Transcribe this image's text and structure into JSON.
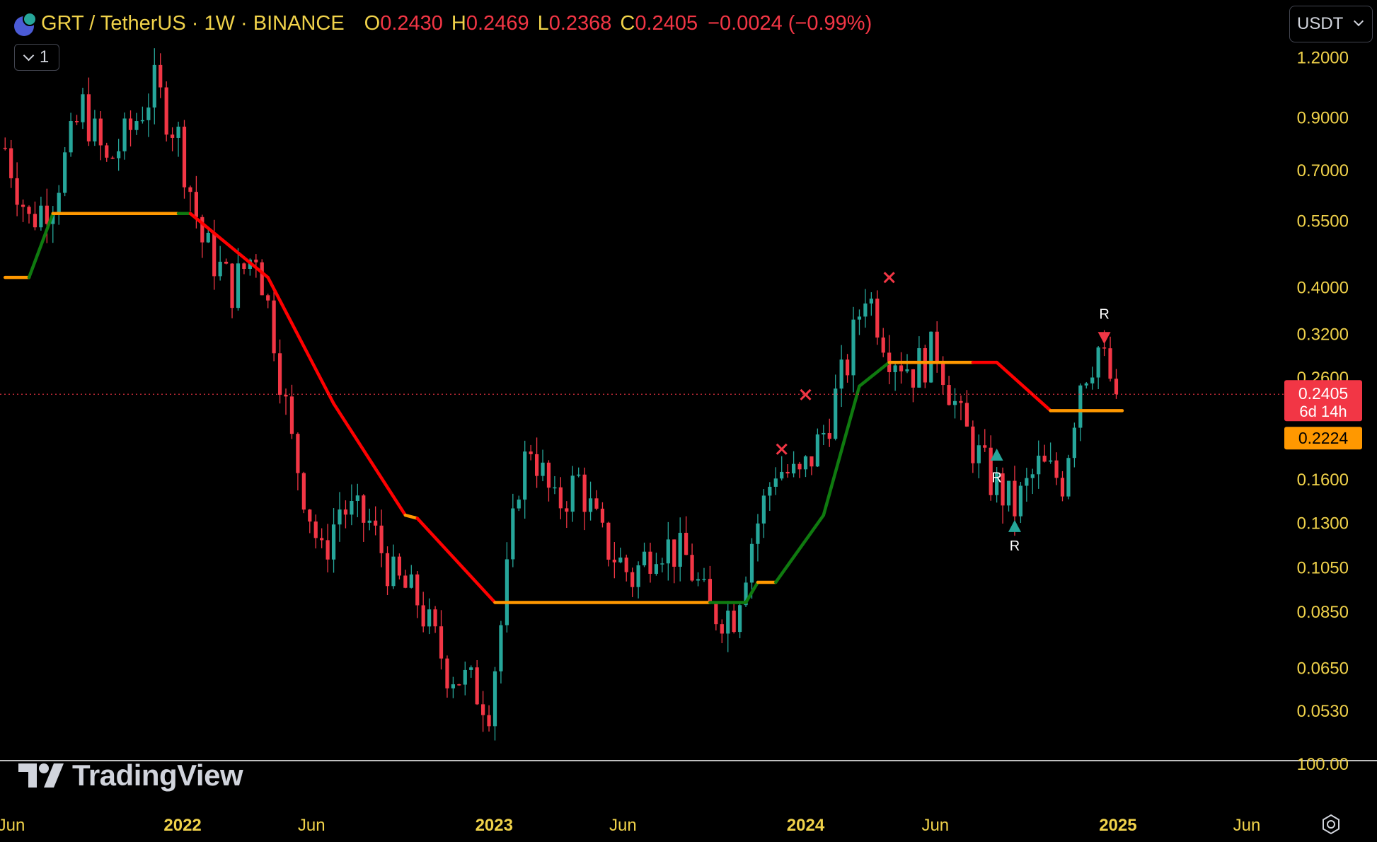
{
  "header": {
    "symbol": "GRT / TetherUS · 1W · BINANCE",
    "ohlc": {
      "o_label": "O",
      "o_value": "0.2430",
      "h_label": "H",
      "h_value": "0.2469",
      "l_label": "L",
      "l_value": "0.2368",
      "c_label": "C",
      "c_value": "0.2405",
      "change": "−0.0024 (−0.99%)"
    },
    "collapse_count": "1"
  },
  "currency": "USDT",
  "branding": "TradingView",
  "colors": {
    "up": "#26a69a",
    "down": "#f23645",
    "trail_red": "#ff0000",
    "trail_green": "#0f7a0f",
    "trail_orange": "#ff9800",
    "axis_text": "#f0d24a",
    "background": "#000000"
  },
  "chart_data": {
    "type": "candlestick",
    "scale": "log",
    "ylim": [
      0.044,
      1.38
    ],
    "y_ticks": [
      "1.2000",
      "0.9000",
      "0.7000",
      "0.5500",
      "0.4000",
      "0.3200",
      "0.2600",
      "0.1600",
      "0.1300",
      "0.1050",
      "0.0850",
      "0.0650",
      "0.0530"
    ],
    "x_ticks": [
      "Jun",
      "2022",
      "Jun",
      "2023",
      "Jun",
      "2024",
      "Jun",
      "2025",
      "Jun"
    ],
    "volume_axis_label": "100.00",
    "last_price": "0.2405",
    "countdown": "6d 14h",
    "line_value_label": "0.2224",
    "anchors": [
      [
        "2021-06-07",
        0.78
      ],
      [
        "2021-07-05",
        0.55
      ],
      [
        "2021-08-02",
        0.62
      ],
      [
        "2021-09-06",
        0.95
      ],
      [
        "2021-10-04",
        0.72
      ],
      [
        "2021-11-01",
        0.85
      ],
      [
        "2021-11-29",
        1.05
      ],
      [
        "2021-12-27",
        0.82
      ],
      [
        "2022-01-24",
        0.5
      ],
      [
        "2022-02-28",
        0.4
      ],
      [
        "2022-03-28",
        0.48
      ],
      [
        "2022-04-18",
        0.32
      ],
      [
        "2022-05-09",
        0.19
      ],
      [
        "2022-06-13",
        0.11
      ],
      [
        "2022-07-04",
        0.14
      ],
      [
        "2022-08-08",
        0.13
      ],
      [
        "2022-09-05",
        0.1
      ],
      [
        "2022-10-03",
        0.09
      ],
      [
        "2022-11-07",
        0.065
      ],
      [
        "2022-12-05",
        0.06
      ],
      [
        "2022-12-26",
        0.055
      ],
      [
        "2023-01-09",
        0.08
      ],
      [
        "2023-01-30",
        0.16
      ],
      [
        "2023-02-13",
        0.19
      ],
      [
        "2023-03-13",
        0.14
      ],
      [
        "2023-04-10",
        0.16
      ],
      [
        "2023-05-08",
        0.12
      ],
      [
        "2023-06-12",
        0.1
      ],
      [
        "2023-07-10",
        0.12
      ],
      [
        "2023-08-14",
        0.11
      ],
      [
        "2023-09-11",
        0.085
      ],
      [
        "2023-10-09",
        0.085
      ],
      [
        "2023-10-30",
        0.12
      ],
      [
        "2023-11-27",
        0.17
      ],
      [
        "2023-12-25",
        0.16
      ],
      [
        "2024-01-22",
        0.2
      ],
      [
        "2024-02-19",
        0.28
      ],
      [
        "2024-03-11",
        0.4
      ],
      [
        "2024-04-08",
        0.3
      ],
      [
        "2024-05-06",
        0.27
      ],
      [
        "2024-06-03",
        0.3
      ],
      [
        "2024-07-01",
        0.21
      ],
      [
        "2024-08-05",
        0.16
      ],
      [
        "2024-09-02",
        0.14
      ],
      [
        "2024-09-30",
        0.17
      ],
      [
        "2024-10-28",
        0.16
      ],
      [
        "2024-11-18",
        0.26
      ],
      [
        "2024-12-09",
        0.3
      ],
      [
        "2024-12-30",
        0.2405
      ]
    ],
    "trail_line": [
      {
        "date": "2021-06-07",
        "value": 0.42,
        "color": "orange"
      },
      {
        "date": "2021-07-05",
        "value": 0.42,
        "color": "green"
      },
      {
        "date": "2021-08-02",
        "value": 0.57,
        "color": "orange"
      },
      {
        "date": "2021-12-27",
        "value": 0.57,
        "color": "green"
      },
      {
        "date": "2022-01-10",
        "value": 0.57,
        "color": "red"
      },
      {
        "date": "2022-04-11",
        "value": 0.42,
        "color": "red"
      },
      {
        "date": "2022-06-27",
        "value": 0.23,
        "color": "red"
      },
      {
        "date": "2022-09-19",
        "value": 0.135,
        "color": "orange"
      },
      {
        "date": "2022-10-03",
        "value": 0.133,
        "color": "red"
      },
      {
        "date": "2023-01-02",
        "value": 0.089,
        "color": "orange"
      },
      {
        "date": "2023-09-11",
        "value": 0.089,
        "color": "green"
      },
      {
        "date": "2023-10-23",
        "value": 0.089,
        "color": "green"
      },
      {
        "date": "2023-11-06",
        "value": 0.098,
        "color": "orange"
      },
      {
        "date": "2023-11-27",
        "value": 0.098,
        "color": "green"
      },
      {
        "date": "2024-01-22",
        "value": 0.135,
        "color": "green"
      },
      {
        "date": "2024-03-04",
        "value": 0.25,
        "color": "green"
      },
      {
        "date": "2024-04-08",
        "value": 0.28,
        "color": "orange"
      },
      {
        "date": "2024-07-15",
        "value": 0.28,
        "color": "red"
      },
      {
        "date": "2024-08-12",
        "value": 0.28,
        "color": "red"
      },
      {
        "date": "2024-10-14",
        "value": 0.2224,
        "color": "orange"
      },
      {
        "date": "2025-01-06",
        "value": 0.2224,
        "color": "orange"
      }
    ],
    "markers": [
      {
        "date": "2023-12-04",
        "value": 0.185,
        "shape": "x",
        "color": "#f23645"
      },
      {
        "date": "2024-01-01",
        "value": 0.24,
        "shape": "x",
        "color": "#f23645"
      },
      {
        "date": "2024-04-08",
        "value": 0.42,
        "shape": "x",
        "color": "#f23645"
      },
      {
        "date": "2024-08-12",
        "value": 0.18,
        "shape": "triangle-up",
        "color": "#26a69a"
      },
      {
        "date": "2024-09-02",
        "value": 0.128,
        "shape": "triangle-up",
        "color": "#26a69a"
      },
      {
        "date": "2024-12-16",
        "value": 0.315,
        "shape": "triangle-down",
        "color": "#f23645"
      }
    ],
    "text_labels": [
      {
        "date": "2024-08-12",
        "value": 0.158,
        "text": "R"
      },
      {
        "date": "2024-09-02",
        "value": 0.114,
        "text": "R"
      },
      {
        "date": "2024-12-16",
        "value": 0.345,
        "text": "R"
      }
    ]
  }
}
